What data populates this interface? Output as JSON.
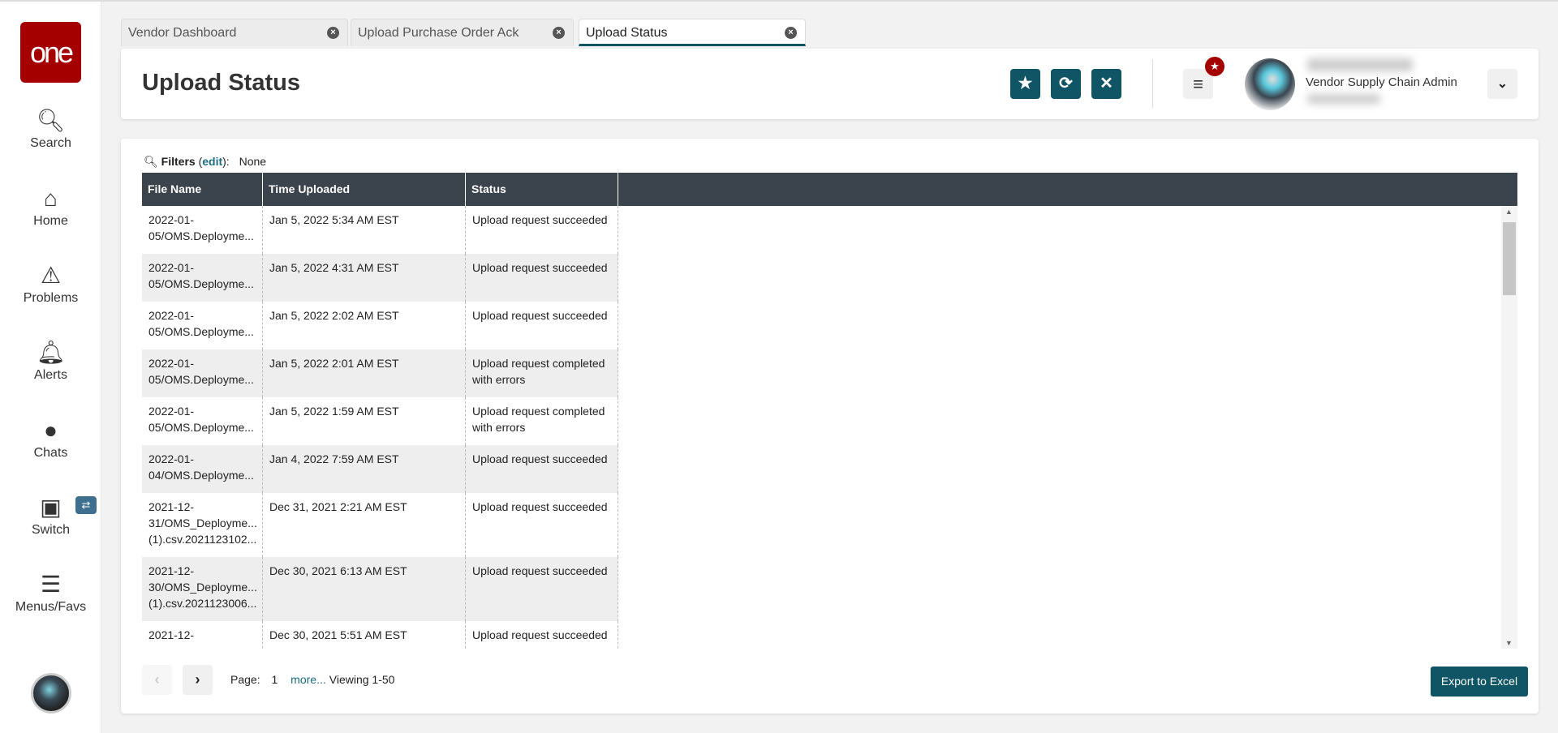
{
  "sidebar": {
    "logo": "one",
    "items": [
      {
        "label": "Search",
        "icon": "search-icon"
      },
      {
        "label": "Home",
        "icon": "home-icon"
      },
      {
        "label": "Problems",
        "icon": "warning-icon"
      },
      {
        "label": "Alerts",
        "icon": "bell-icon"
      },
      {
        "label": "Chats",
        "icon": "chat-icon"
      },
      {
        "label": "Switch",
        "icon": "switch-icon"
      },
      {
        "label": "Menus/Favs",
        "icon": "menu-icon"
      }
    ]
  },
  "tabs": [
    {
      "label": "Vendor Dashboard"
    },
    {
      "label": "Upload Purchase Order Ack"
    },
    {
      "label": "Upload Status",
      "active": true
    }
  ],
  "header": {
    "title": "Upload Status",
    "role": "Vendor Supply Chain Admin"
  },
  "filters": {
    "label": "Filters",
    "edit": "edit",
    "value": "None"
  },
  "table": {
    "columns": [
      "File Name",
      "Time Uploaded",
      "Status"
    ],
    "rows": [
      {
        "file": [
          "2022-01-",
          "05/OMS.Deployme..."
        ],
        "time": "Jan 5, 2022 5:34 AM EST",
        "status": [
          "Upload request succeeded"
        ]
      },
      {
        "file": [
          "2022-01-",
          "05/OMS.Deployme..."
        ],
        "time": "Jan 5, 2022 4:31 AM EST",
        "status": [
          "Upload request succeeded"
        ]
      },
      {
        "file": [
          "2022-01-",
          "05/OMS.Deployme..."
        ],
        "time": "Jan 5, 2022 2:02 AM EST",
        "status": [
          "Upload request succeeded"
        ]
      },
      {
        "file": [
          "2022-01-",
          "05/OMS.Deployme..."
        ],
        "time": "Jan 5, 2022 2:01 AM EST",
        "status": [
          "Upload request completed",
          "with errors"
        ]
      },
      {
        "file": [
          "2022-01-",
          "05/OMS.Deployme..."
        ],
        "time": "Jan 5, 2022 1:59 AM EST",
        "status": [
          "Upload request completed",
          "with errors"
        ]
      },
      {
        "file": [
          "2022-01-",
          "04/OMS.Deployme..."
        ],
        "time": "Jan 4, 2022 7:59 AM EST",
        "status": [
          "Upload request succeeded"
        ]
      },
      {
        "file": [
          "2021-12-",
          "31/OMS_Deployme...",
          "(1).csv.2021123102..."
        ],
        "time": "Dec 31, 2021 2:21 AM EST",
        "status": [
          "Upload request succeeded"
        ]
      },
      {
        "file": [
          "2021-12-",
          "30/OMS_Deployme...",
          "(1).csv.2021123006..."
        ],
        "time": "Dec 30, 2021 6:13 AM EST",
        "status": [
          "Upload request succeeded"
        ]
      },
      {
        "file": [
          "2021-12-"
        ],
        "time": "Dec 30, 2021 5:51 AM EST",
        "status": [
          "Upload request succeeded"
        ]
      }
    ]
  },
  "pager": {
    "page_label": "Page:",
    "page": "1",
    "more": "more...",
    "viewing": "Viewing 1-50"
  },
  "export_label": "Export to Excel"
}
